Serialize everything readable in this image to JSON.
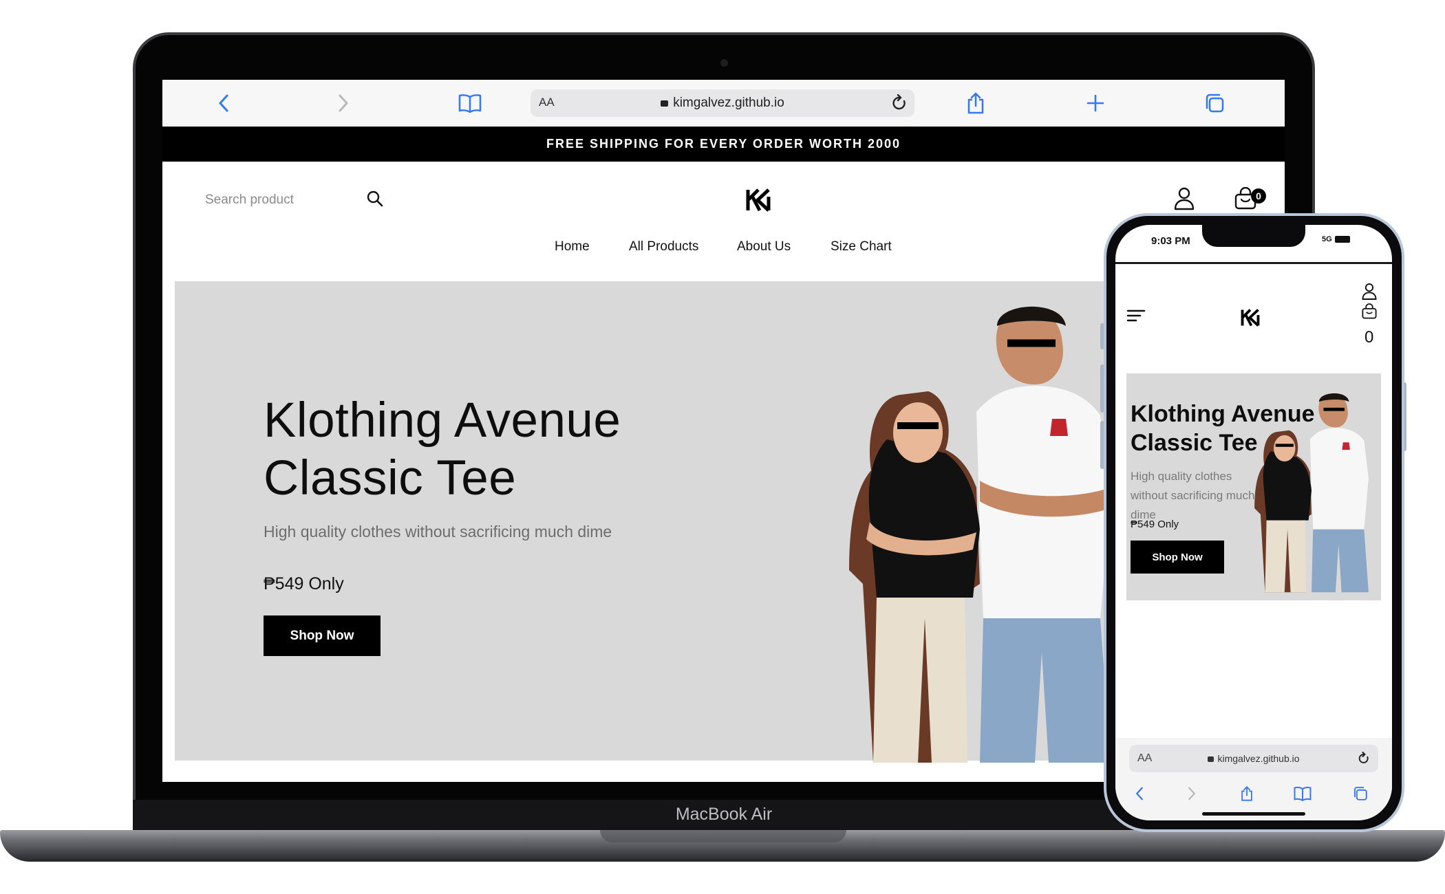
{
  "desktop": {
    "browser": {
      "url": "kimgalvez.github.io",
      "text_size_label": "AA"
    },
    "promo_banner": "FREE SHIPPING FOR EVERY ORDER WORTH 2000",
    "header": {
      "search_placeholder": "Search product",
      "cart_count": "0"
    },
    "nav": [
      {
        "label": "Home"
      },
      {
        "label": "All Products"
      },
      {
        "label": "About Us"
      },
      {
        "label": "Size Chart"
      }
    ],
    "hero": {
      "title_line1": "Klothing Avenue",
      "title_line2": "Classic Tee",
      "subtitle": "High quality clothes without sacrificing much dime",
      "price": "₱549 Only",
      "cta": "Shop Now"
    },
    "device_label": "MacBook Air"
  },
  "mobile": {
    "status": {
      "time": "9:03 PM",
      "network": "5G"
    },
    "cart_count": "0",
    "hero": {
      "title_line1": "Klothing Avenue",
      "title_line2": "Classic Tee",
      "subtitle": "High quality clothes without sacrificing much dime",
      "price": "₱549 Only",
      "cta": "Shop Now"
    },
    "browser": {
      "url": "kimgalvez.github.io",
      "text_size_label": "AA"
    }
  },
  "colors": {
    "hero_bg": "#d9d9d9",
    "primary": "#000000",
    "browser_bar": "#f7f7f7",
    "safari_blue": "#3478f6"
  },
  "icons": [
    "back-icon",
    "forward-icon",
    "bookmarks-icon",
    "reload-icon",
    "share-icon",
    "new-tab-icon",
    "tabs-icon",
    "search-icon",
    "user-icon",
    "cart-icon",
    "menu-icon"
  ]
}
